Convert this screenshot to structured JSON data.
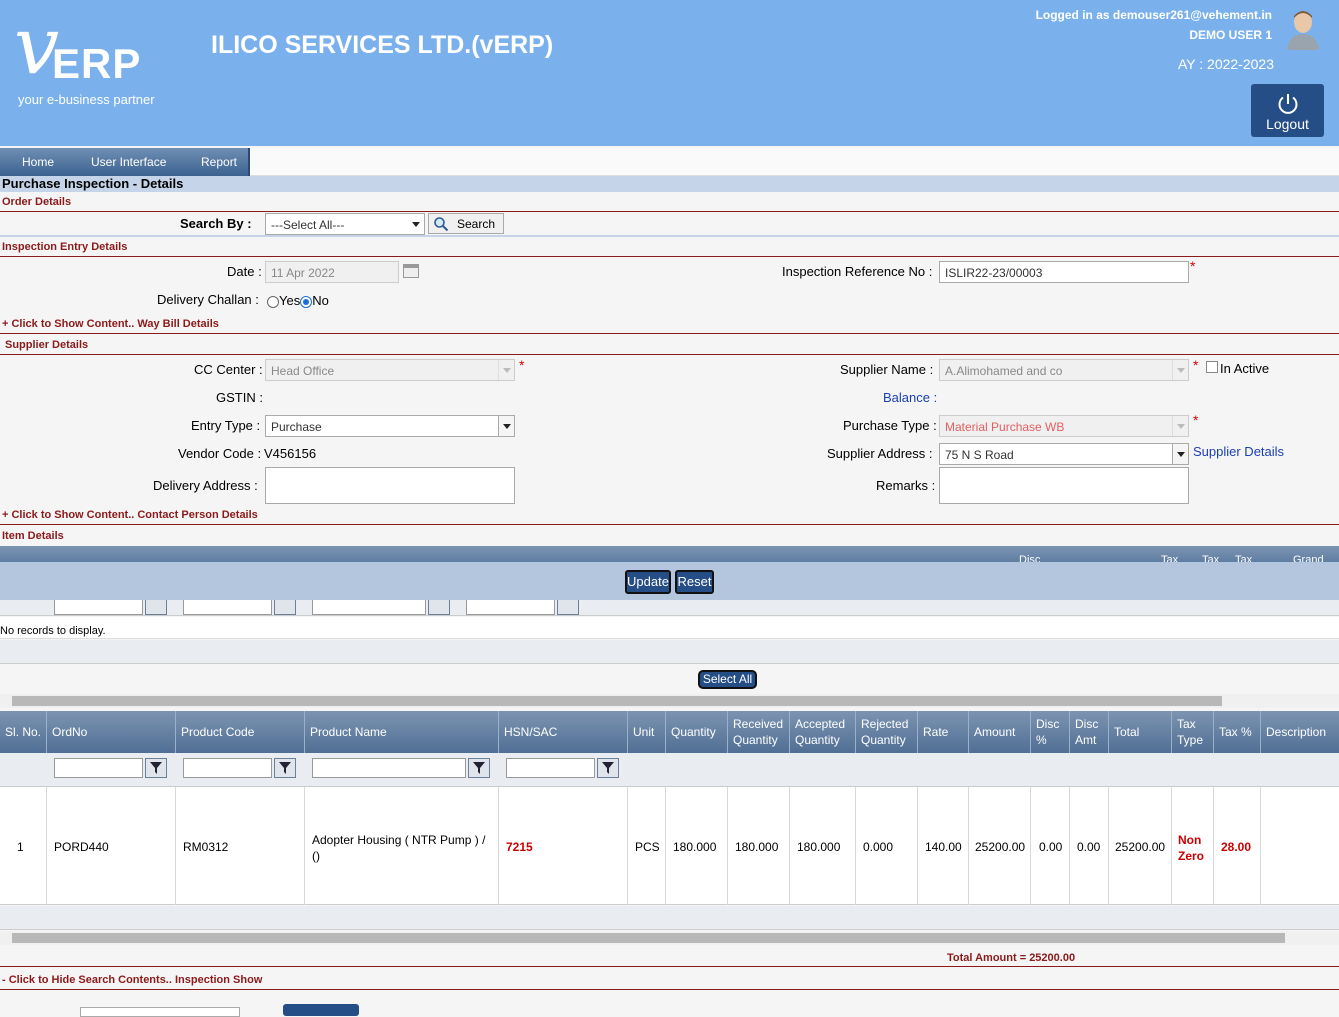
{
  "header": {
    "logo_v": "v",
    "logo_erp": "ERP",
    "logo_tagline": "your e-business partner",
    "app_title": "ILICO SERVICES LTD.(vERP)",
    "logged_in": "Logged in as demouser261@vehement.in",
    "user_name": "DEMO USER 1",
    "academic_year": "AY : 2022-2023",
    "logout_label": "Logout"
  },
  "nav": {
    "items": [
      "Home",
      "User Interface",
      "Report"
    ]
  },
  "page_title": "Purchase Inspection - Details",
  "order_details": {
    "heading": "Order Details",
    "search_by_label": "Search By :",
    "search_select": "---Select All---",
    "search_button": "Search"
  },
  "inspection_entry": {
    "heading": "Inspection Entry Details",
    "date_label": "Date :",
    "date_value": "11 Apr 2022",
    "ref_label": "Inspection Reference No :",
    "ref_value": "ISLIR22-23/00003",
    "delivery_challan_label": "Delivery Challan :",
    "yes_label": "Yes",
    "no_label": "No",
    "waybill_toggle": "+ Click to Show Content..  Way Bill Details"
  },
  "supplier": {
    "heading": "Supplier Details",
    "cc_center_label": "CC Center :",
    "cc_center_value": "Head Office",
    "supplier_name_label": "Supplier Name :",
    "supplier_name_value": "A.Alimohamed and co",
    "in_active_label": "In Active",
    "gstin_label": "GSTIN :",
    "balance_label": "Balance :",
    "entry_type_label": "Entry Type :",
    "entry_type_value": "Purchase",
    "purchase_type_label": "Purchase Type :",
    "purchase_type_value": "Material Purchase WB",
    "vendor_code_label": "Vendor Code :",
    "vendor_code_value": "V456156",
    "supplier_address_label": "Supplier Address :",
    "supplier_address_value": "75 N S Road",
    "supplier_details_link": "Supplier Details",
    "delivery_address_label": "Delivery Address :",
    "remarks_label": "Remarks :",
    "contact_toggle": "+ Click to Show Content..  Contact Person Details"
  },
  "item_details": {
    "heading": "Item Details",
    "partial_headers": [
      "Disc",
      "Tax",
      "Tax",
      "Tax",
      "Grand"
    ],
    "update_button": "Update",
    "reset_button": "Reset",
    "no_records": "No records to display.",
    "select_all_button": "Select All"
  },
  "grid": {
    "columns": [
      "Sl. No.",
      "OrdNo",
      "Product Code",
      "Product Name",
      "HSN/SAC",
      "Unit",
      "Quantity",
      "Received Quantity",
      "Accepted Quantity",
      "Rejected Quantity",
      "Rate",
      "Amount",
      "Disc %",
      "Disc Amt",
      "Total",
      "Tax Type",
      "Tax %",
      "Description"
    ],
    "rows": [
      {
        "sl_no": "1",
        "ord_no": "PORD440",
        "product_code": "RM0312",
        "product_name": "Adopter Housing ( NTR Pump ) / ()",
        "hsn": "7215",
        "unit": "PCS",
        "quantity": "180.000",
        "received": "180.000",
        "accepted": "180.000",
        "rejected": "0.000",
        "rate": "140.00",
        "amount": "25200.00",
        "disc_pct": "0.00",
        "disc_amt": "0.00",
        "total": "25200.00",
        "tax_type": "Non Zero",
        "tax_pct": "28.00",
        "description": ""
      }
    ],
    "total_amount": "Total Amount  = 25200.00"
  },
  "footer": {
    "hide_toggle": "- Click to Hide Search Contents..  Inspection Show"
  },
  "colors": {
    "header_bg": "#7ab1ec",
    "accent_dark": "#254d86",
    "section_red": "#8b1a1a",
    "required": "#dd0000",
    "hsn_red": "#cc0000"
  }
}
